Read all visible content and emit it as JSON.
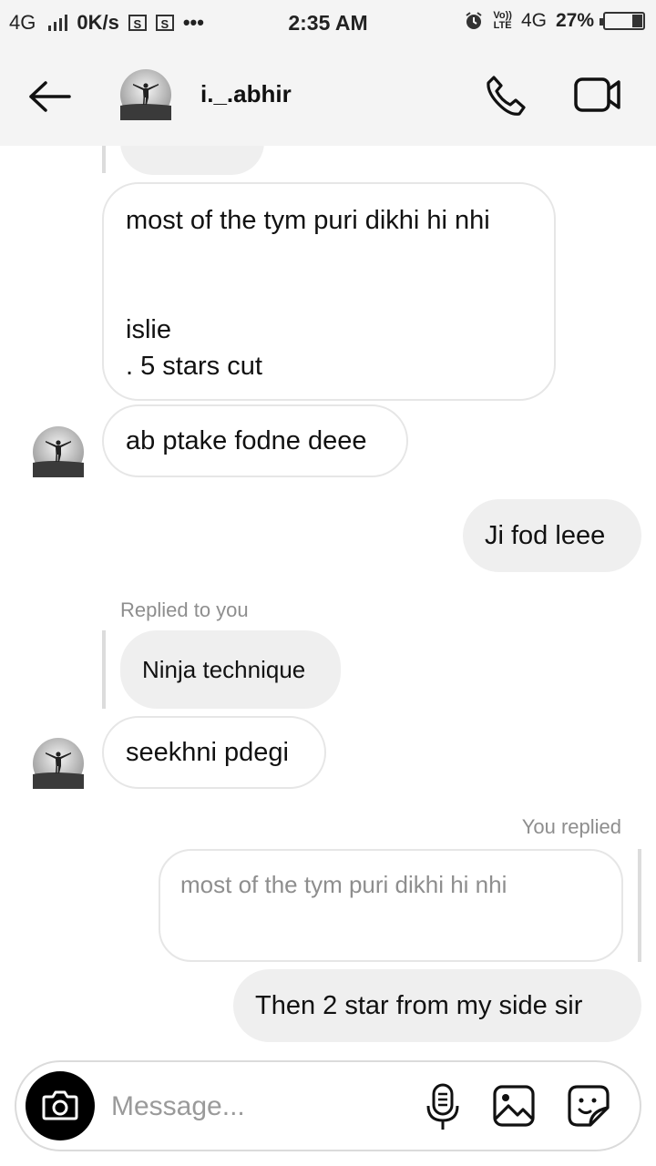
{
  "status_bar": {
    "network": "4G",
    "speed": "0K/s",
    "notif_icon": "S",
    "more": "•••",
    "time": "2:35 AM",
    "volte_top": "Vo))",
    "volte_bottom": "LTE",
    "network2": "4G",
    "battery": "27%",
    "battery_fraction": 0.27
  },
  "header": {
    "username": "i._.abhir",
    "icons": [
      "back-arrow-icon",
      "phone-icon",
      "video-camera-icon"
    ]
  },
  "thread": {
    "message_1": {
      "line1": "most of the tym puri dikhi hi nhi",
      "line2": "islie",
      "line3": ". 5 stars cut"
    },
    "message_2": "ab ptake fodne deee",
    "message_3": "Ji fod leee",
    "reply_label_1": "Replied to you",
    "quoted_1": "Ninja technique",
    "message_4": "seekhni pdegi",
    "reply_label_2": "You replied",
    "quoted_2": "most of the tym puri dikhi hi nhi",
    "message_5": "Then 2 star from my side sir"
  },
  "composer": {
    "placeholder": "Message...",
    "icons": [
      "camera-icon",
      "microphone-icon",
      "gallery-icon",
      "sticker-icon"
    ]
  },
  "colors": {
    "outgoing_bubble": "#efefef",
    "incoming_border": "#e6e6e6",
    "meta_text": "#8e8e8e",
    "header_bg": "#f4f4f4"
  }
}
